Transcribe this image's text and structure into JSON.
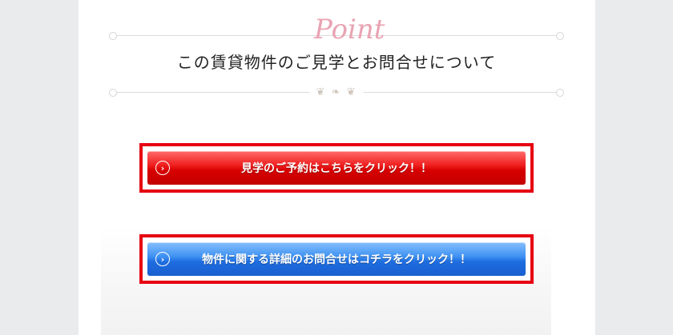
{
  "section": {
    "decoration_word": "Point",
    "title": "この賃貸物件のご見学とお問合せについて"
  },
  "buttons": {
    "visit": {
      "label": "見学のご予約はこちらをクリック！！",
      "icon": "chevron-right-circle-icon",
      "color": "#e60000"
    },
    "inquiry": {
      "label": "物件に関する詳細のお問合せはコチラをクリック！！",
      "icon": "chevron-right-circle-icon",
      "color": "#2f7fe8"
    }
  },
  "colors": {
    "frame_border": "#e60012",
    "page_background": "#eaebec",
    "ornament": "#e9a3b2"
  }
}
